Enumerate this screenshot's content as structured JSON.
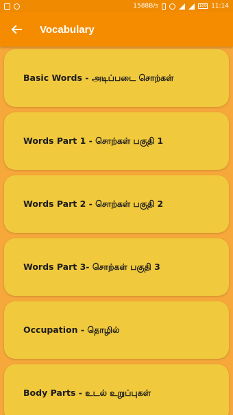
{
  "status_bar": {
    "speed": "1588B/s",
    "time": "11:14",
    "battery": "100"
  },
  "app_bar": {
    "title": "Vocabulary",
    "back_icon": "arrow-left-icon"
  },
  "colors": {
    "app_bar": "#f58c00",
    "status_bar": "#f08a00",
    "background": "#f7a83b",
    "card": "#f1c93d",
    "card_text": "#1c1c1c"
  },
  "items": [
    {
      "label": "Basic Words - அடிப்படை சொற்கள்"
    },
    {
      "label": "Words Part 1 - சொற்கள் பகுதி 1"
    },
    {
      "label": "Words Part 2 - சொற்கள் பகுதி 2"
    },
    {
      "label": "Words Part 3- சொற்கள் பகுதி 3"
    },
    {
      "label": "Occupation - தொழில்"
    },
    {
      "label": "Body Parts - உடல் உறுப்புகள்"
    }
  ]
}
